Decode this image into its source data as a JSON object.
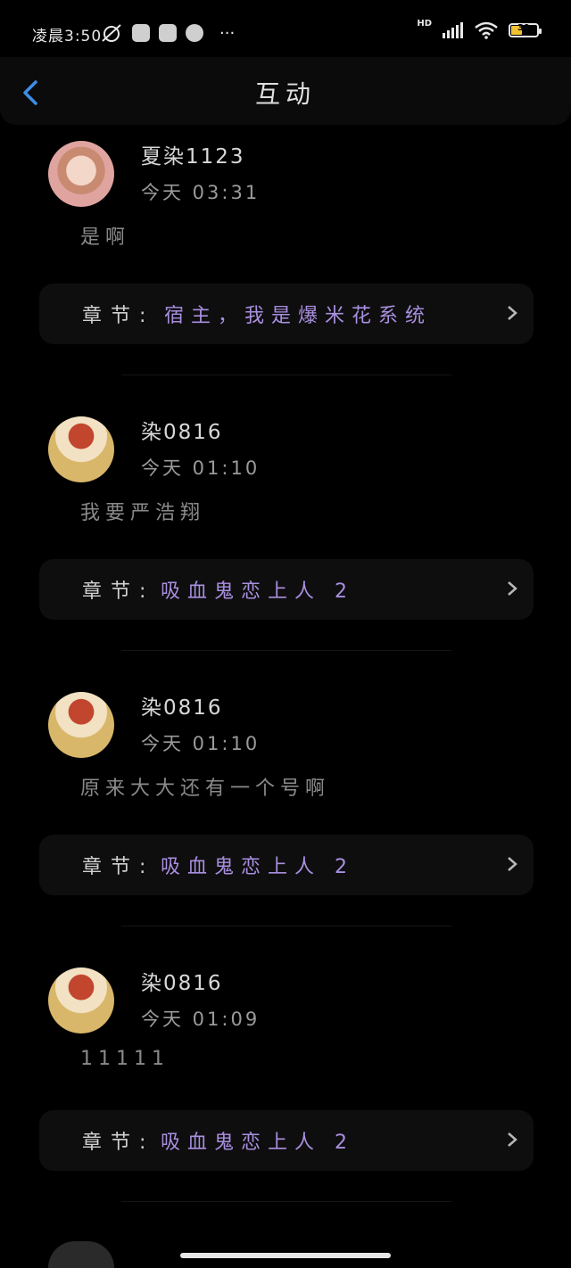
{
  "status_bar": {
    "time": "凌晨3:50",
    "battery": "39",
    "hd": "HD",
    "more": "···"
  },
  "header": {
    "title": "互动"
  },
  "chapter_prefix": "章节:",
  "items": [
    {
      "username": "夏染1123",
      "time": "今天 03:31",
      "comment": "是啊",
      "chapter": "宿主，我是爆米花系统"
    },
    {
      "username": "染0816",
      "time": "今天 01:10",
      "comment": "我要严浩翔",
      "chapter": "吸血鬼恋上人 2"
    },
    {
      "username": "染0816",
      "time": "今天 01:10",
      "comment": "原来大大还有一个号啊",
      "chapter": "吸血鬼恋上人 2"
    },
    {
      "username": "染0816",
      "time": "今天 01:09",
      "comment": "11111",
      "chapter": "吸血鬼恋上人 2"
    }
  ]
}
